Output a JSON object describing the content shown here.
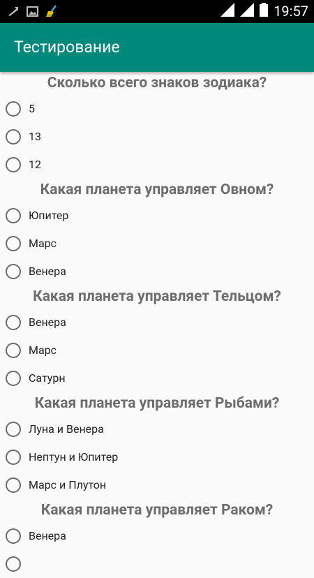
{
  "status_bar": {
    "time": "19:57",
    "icons_left": [
      "usb-icon",
      "image-icon",
      "broom-icon"
    ],
    "icons_right": [
      "signal-icon",
      "signal-icon",
      "battery-icon"
    ]
  },
  "app_bar": {
    "title": "Тестирование",
    "color": "#00897b"
  },
  "questions": [
    {
      "text": "Сколько всего знаков зодиака?",
      "options": [
        "5",
        "13",
        "12"
      ]
    },
    {
      "text": "Какая планета управляет Овном?",
      "options": [
        "Юпитер",
        "Марс",
        "Венера"
      ]
    },
    {
      "text": "Какая планета управляет Тельцом?",
      "options": [
        "Венера",
        "Марс",
        "Сатурн"
      ]
    },
    {
      "text": "Какая планета управляет Рыбами?",
      "options": [
        "Луна и Венера",
        "Нептун и Юпитер",
        "Марс и Плутон"
      ]
    },
    {
      "text": "Какая планета управляет Раком?",
      "options": [
        "Венера"
      ]
    }
  ]
}
